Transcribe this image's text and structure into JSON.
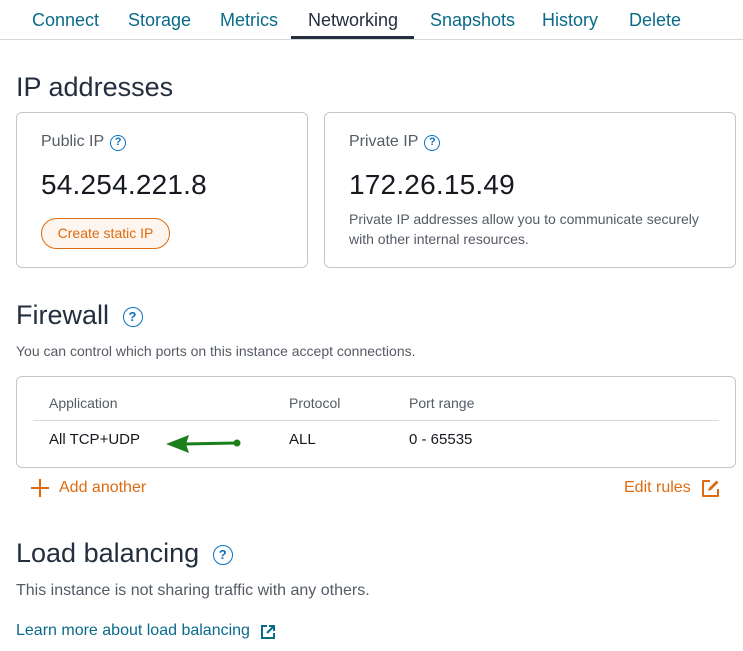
{
  "tabs": [
    {
      "label": "Connect"
    },
    {
      "label": "Storage"
    },
    {
      "label": "Metrics"
    },
    {
      "label": "Networking",
      "active": true
    },
    {
      "label": "Snapshots"
    },
    {
      "label": "History"
    },
    {
      "label": "Delete"
    }
  ],
  "ip_section": {
    "title": "IP addresses",
    "public": {
      "label": "Public IP",
      "value": "54.254.221.8",
      "button": "Create static IP"
    },
    "private": {
      "label": "Private IP",
      "value": "172.26.15.49",
      "description": "Private IP addresses allow you to communicate securely with other internal resources."
    }
  },
  "firewall": {
    "title": "Firewall",
    "description": "You can control which ports on this instance accept connections.",
    "columns": [
      "Application",
      "Protocol",
      "Port range"
    ],
    "rows": [
      {
        "application": "All TCP+UDP",
        "protocol": "ALL",
        "port_range": "0 - 65535"
      }
    ],
    "add_label": "Add another",
    "edit_label": "Edit rules"
  },
  "load_balancing": {
    "title": "Load balancing",
    "description": "This instance is not sharing traffic with any others.",
    "link": "Learn more about load balancing"
  },
  "icons": {
    "help": "?"
  },
  "colors": {
    "accent_orange": "#dd6b10",
    "link_blue": "#0a6a8a",
    "help_blue": "#0a73bb",
    "annotation_green": "#1a7f1a"
  }
}
